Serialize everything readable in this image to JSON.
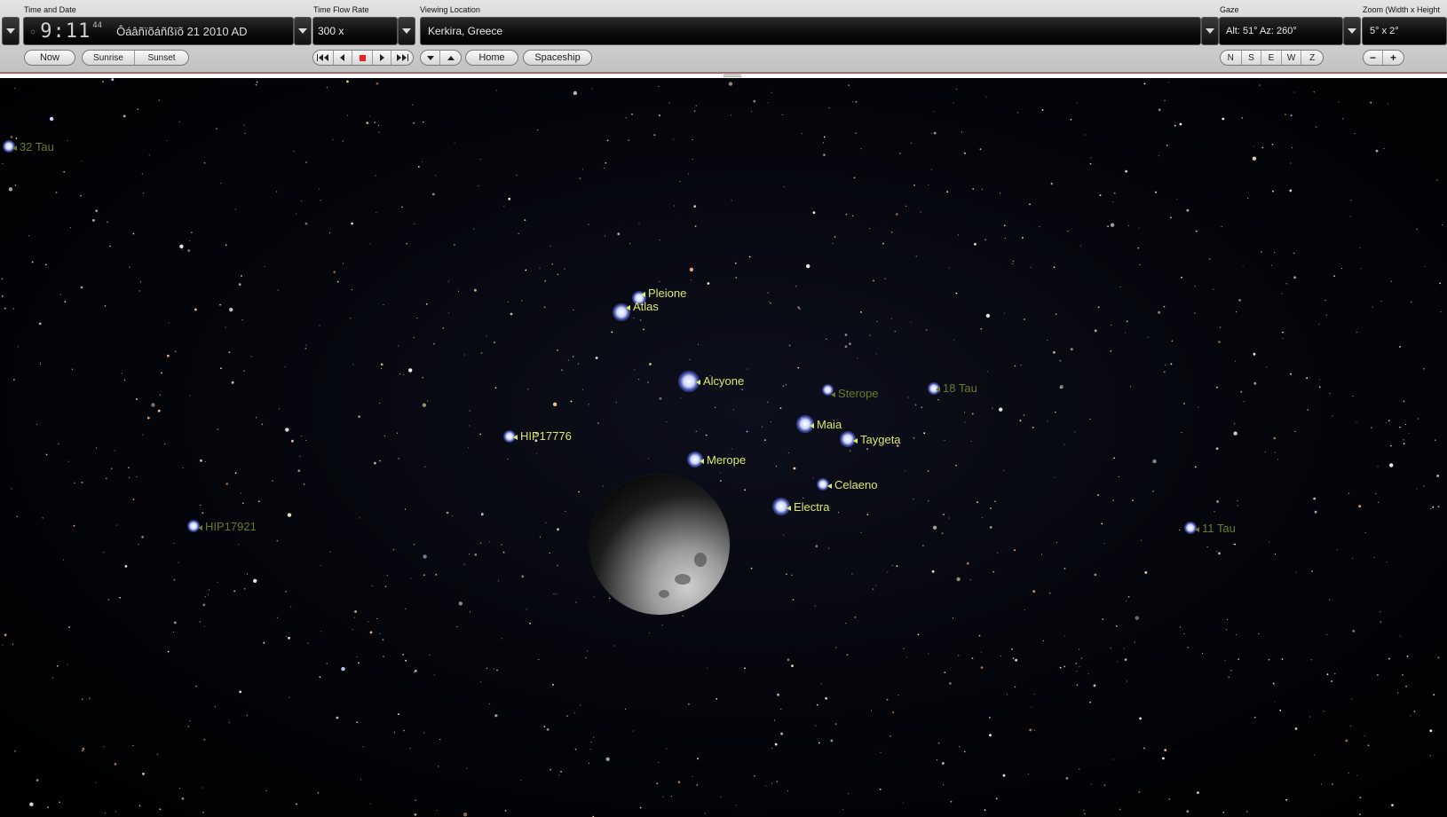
{
  "time_date": {
    "section_label": "Time and Date",
    "time": "9:11",
    "seconds": "44",
    "date": "Ôáâñïõáñßïõ 21   2010 AD",
    "now_label": "Now",
    "sunrise_label": "Sunrise",
    "sunset_label": "Sunset"
  },
  "time_flow": {
    "section_label": "Time Flow Rate",
    "rate": "300 x"
  },
  "location": {
    "section_label": "Viewing Location",
    "value": "Kerkira, Greece",
    "home_label": "Home",
    "spaceship_label": "Spaceship"
  },
  "gaze": {
    "section_label": "Gaze",
    "value": "Alt: 51° Az: 260°",
    "buttons": [
      "N",
      "S",
      "E",
      "W",
      "Z"
    ]
  },
  "zoom": {
    "section_label": "Zoom (Width x Height",
    "value": "5° x 2°",
    "minus_label": "−",
    "plus_label": "+"
  },
  "sky_labels": [
    {
      "text": "32 Tau",
      "style": "dim"
    },
    {
      "text": "Pleione",
      "style": "bright"
    },
    {
      "text": "Atlas",
      "style": "bright"
    },
    {
      "text": "Alcyone",
      "style": "bright"
    },
    {
      "text": "Sterope",
      "style": "dim"
    },
    {
      "text": "18 Tau",
      "style": "dim"
    },
    {
      "text": "HIP17776",
      "style": "bright"
    },
    {
      "text": "Maia",
      "style": "bright"
    },
    {
      "text": "Taygeta",
      "style": "bright"
    },
    {
      "text": "Merope",
      "style": "bright"
    },
    {
      "text": "Celaeno",
      "style": "bright"
    },
    {
      "text": "Electra",
      "style": "bright"
    },
    {
      "text": "HIP17921",
      "style": "dim"
    },
    {
      "text": "11 Tau",
      "style": "dim"
    }
  ],
  "colors": {
    "label_bright": "#d8e86a",
    "label_dim": "#6a7a2c",
    "accent_stop": "#e22222"
  }
}
